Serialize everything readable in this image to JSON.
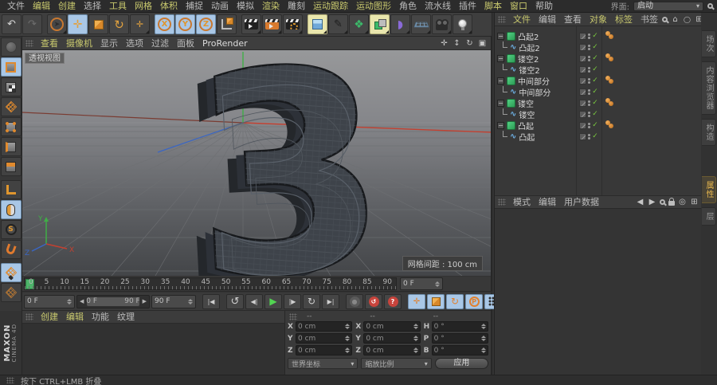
{
  "menubar": {
    "items": [
      {
        "label": "文件",
        "cls": ""
      },
      {
        "label": "编辑",
        "cls": "y"
      },
      {
        "label": "创建",
        "cls": "y"
      },
      {
        "label": "选择",
        "cls": ""
      },
      {
        "label": "工具",
        "cls": "y"
      },
      {
        "label": "网格",
        "cls": "y"
      },
      {
        "label": "体积",
        "cls": "y"
      },
      {
        "label": "捕捉",
        "cls": ""
      },
      {
        "label": "动画",
        "cls": ""
      },
      {
        "label": "模拟",
        "cls": ""
      },
      {
        "label": "渲染",
        "cls": "y"
      },
      {
        "label": "雕刻",
        "cls": ""
      },
      {
        "label": "运动跟踪",
        "cls": "y"
      },
      {
        "label": "运动图形",
        "cls": "y"
      },
      {
        "label": "角色",
        "cls": ""
      },
      {
        "label": "流水线",
        "cls": ""
      },
      {
        "label": "插件",
        "cls": ""
      },
      {
        "label": "脚本",
        "cls": "y"
      },
      {
        "label": "窗口",
        "cls": "y"
      },
      {
        "label": "帮助",
        "cls": ""
      }
    ],
    "interface_label": "界面:",
    "interface_value": "启动"
  },
  "viewport": {
    "menu": [
      {
        "label": "查看",
        "cls": "y"
      },
      {
        "label": "摄像机",
        "cls": "y"
      },
      {
        "label": "显示",
        "cls": ""
      },
      {
        "label": "选项",
        "cls": ""
      },
      {
        "label": "过滤",
        "cls": ""
      },
      {
        "label": "面板",
        "cls": ""
      },
      {
        "label": "ProRender",
        "cls": "w"
      }
    ],
    "view_label": "透视视图",
    "grid_label": "网格间距 : 100 cm",
    "model_glyph": "3",
    "axis_labels": {
      "x": "X",
      "y": "Y",
      "z": "Z"
    }
  },
  "object_manager": {
    "menu": [
      {
        "label": "文件",
        "cls": "y"
      },
      {
        "label": "编辑",
        "cls": ""
      },
      {
        "label": "查看",
        "cls": ""
      },
      {
        "label": "对象",
        "cls": "y"
      },
      {
        "label": "标签",
        "cls": "y"
      },
      {
        "label": "书签",
        "cls": ""
      }
    ],
    "rows": [
      {
        "name": "凸起2",
        "child": "凸起2"
      },
      {
        "name": "镂空2",
        "child": "镂空2"
      },
      {
        "name": "中间部分",
        "child": "中间部分"
      },
      {
        "name": "镂空",
        "child": "镂空"
      },
      {
        "name": "凸起",
        "child": "凸起"
      }
    ]
  },
  "mode_bar": {
    "menu": [
      {
        "label": "模式",
        "cls": ""
      },
      {
        "label": "编辑",
        "cls": ""
      },
      {
        "label": "用户数据",
        "cls": ""
      }
    ]
  },
  "right_tabs": {
    "top": [
      {
        "label": "场次",
        "cls": ""
      },
      {
        "label": "内容浏览器",
        "cls": ""
      },
      {
        "label": "构造",
        "cls": ""
      }
    ],
    "bottom": [
      {
        "label": "属性",
        "cls": "active"
      },
      {
        "label": "层",
        "cls": ""
      }
    ]
  },
  "materials": {
    "menu": [
      {
        "label": "创建",
        "cls": "y"
      },
      {
        "label": "编辑",
        "cls": "y"
      },
      {
        "label": "功能",
        "cls": ""
      },
      {
        "label": "纹理",
        "cls": ""
      }
    ]
  },
  "timeline": {
    "ticks": [
      "0",
      "5",
      "10",
      "15",
      "20",
      "25",
      "30",
      "35",
      "40",
      "45",
      "50",
      "55",
      "60",
      "65",
      "70",
      "75",
      "80",
      "85",
      "90"
    ],
    "frame_field": "0 F"
  },
  "transport": {
    "current_frame": "0 F",
    "range_start": "0 F",
    "range_end": "90 F",
    "end_frame": "90 F"
  },
  "coordinates": {
    "headers": [
      "--",
      "--",
      "--"
    ],
    "col1": [
      {
        "label": "X",
        "value": "0 cm"
      },
      {
        "label": "Y",
        "value": "0 cm"
      },
      {
        "label": "Z",
        "value": "0 cm"
      }
    ],
    "col2": [
      {
        "label": "X",
        "value": "0 cm"
      },
      {
        "label": "Y",
        "value": "0 cm"
      },
      {
        "label": "Z",
        "value": "0 cm"
      }
    ],
    "col3": [
      {
        "label": "H",
        "value": "0 °"
      },
      {
        "label": "P",
        "value": "0 °"
      },
      {
        "label": "B",
        "value": "0 °"
      }
    ],
    "coord_system": "世界坐标",
    "scale_mode": "缩放比例",
    "apply": "应用"
  },
  "status": {
    "hint": "按下 CTRL+LMB 折叠"
  },
  "logo": {
    "brand": "MAXON",
    "product": "CINEMA 4D"
  },
  "icons": {
    "undo": "↶",
    "redo": "↷",
    "cursor": "➤",
    "move": "✛",
    "rotate": "↻",
    "x": "X",
    "y": "Y",
    "z": "Z",
    "pen": "✎",
    "subdiv": "❖",
    "bend": "◗",
    "pan": "✛",
    "dolly": "↕",
    "orbit": "↻",
    "maximize": "▣",
    "home": "⌂",
    "oval": "◯",
    "plus": "⊞",
    "back": "◀",
    "forward": "▶",
    "target": "◎",
    "collapse": "−",
    "check": "✓",
    "spline": "∿",
    "goto_start": "|◀",
    "play_backwards": "↺",
    "prev_frame": "◀|",
    "play": "▶",
    "next_frame": "|▶",
    "loop": "↻",
    "goto_end": "▶|",
    "record": "●",
    "autokey": "↺",
    "help": "?",
    "key_position": "✛",
    "key_rotation": "↻",
    "key_param": "P",
    "range_left": "◀",
    "range_right": "▶",
    "dropdown": "▾",
    "snap_s": "S"
  },
  "colors": {
    "accent_orange": "#e2a13e",
    "select_blue": "#a9c7e6",
    "select_yellow": "#e9e6ad",
    "axis_red": "#c44030",
    "axis_green": "#3fae46",
    "axis_blue": "#3a66c4",
    "tag_orange": "#d98a3a",
    "check_green": "#79c83f",
    "object_green": "#3dbd6e",
    "spline_blue": "#6fb3e8"
  }
}
